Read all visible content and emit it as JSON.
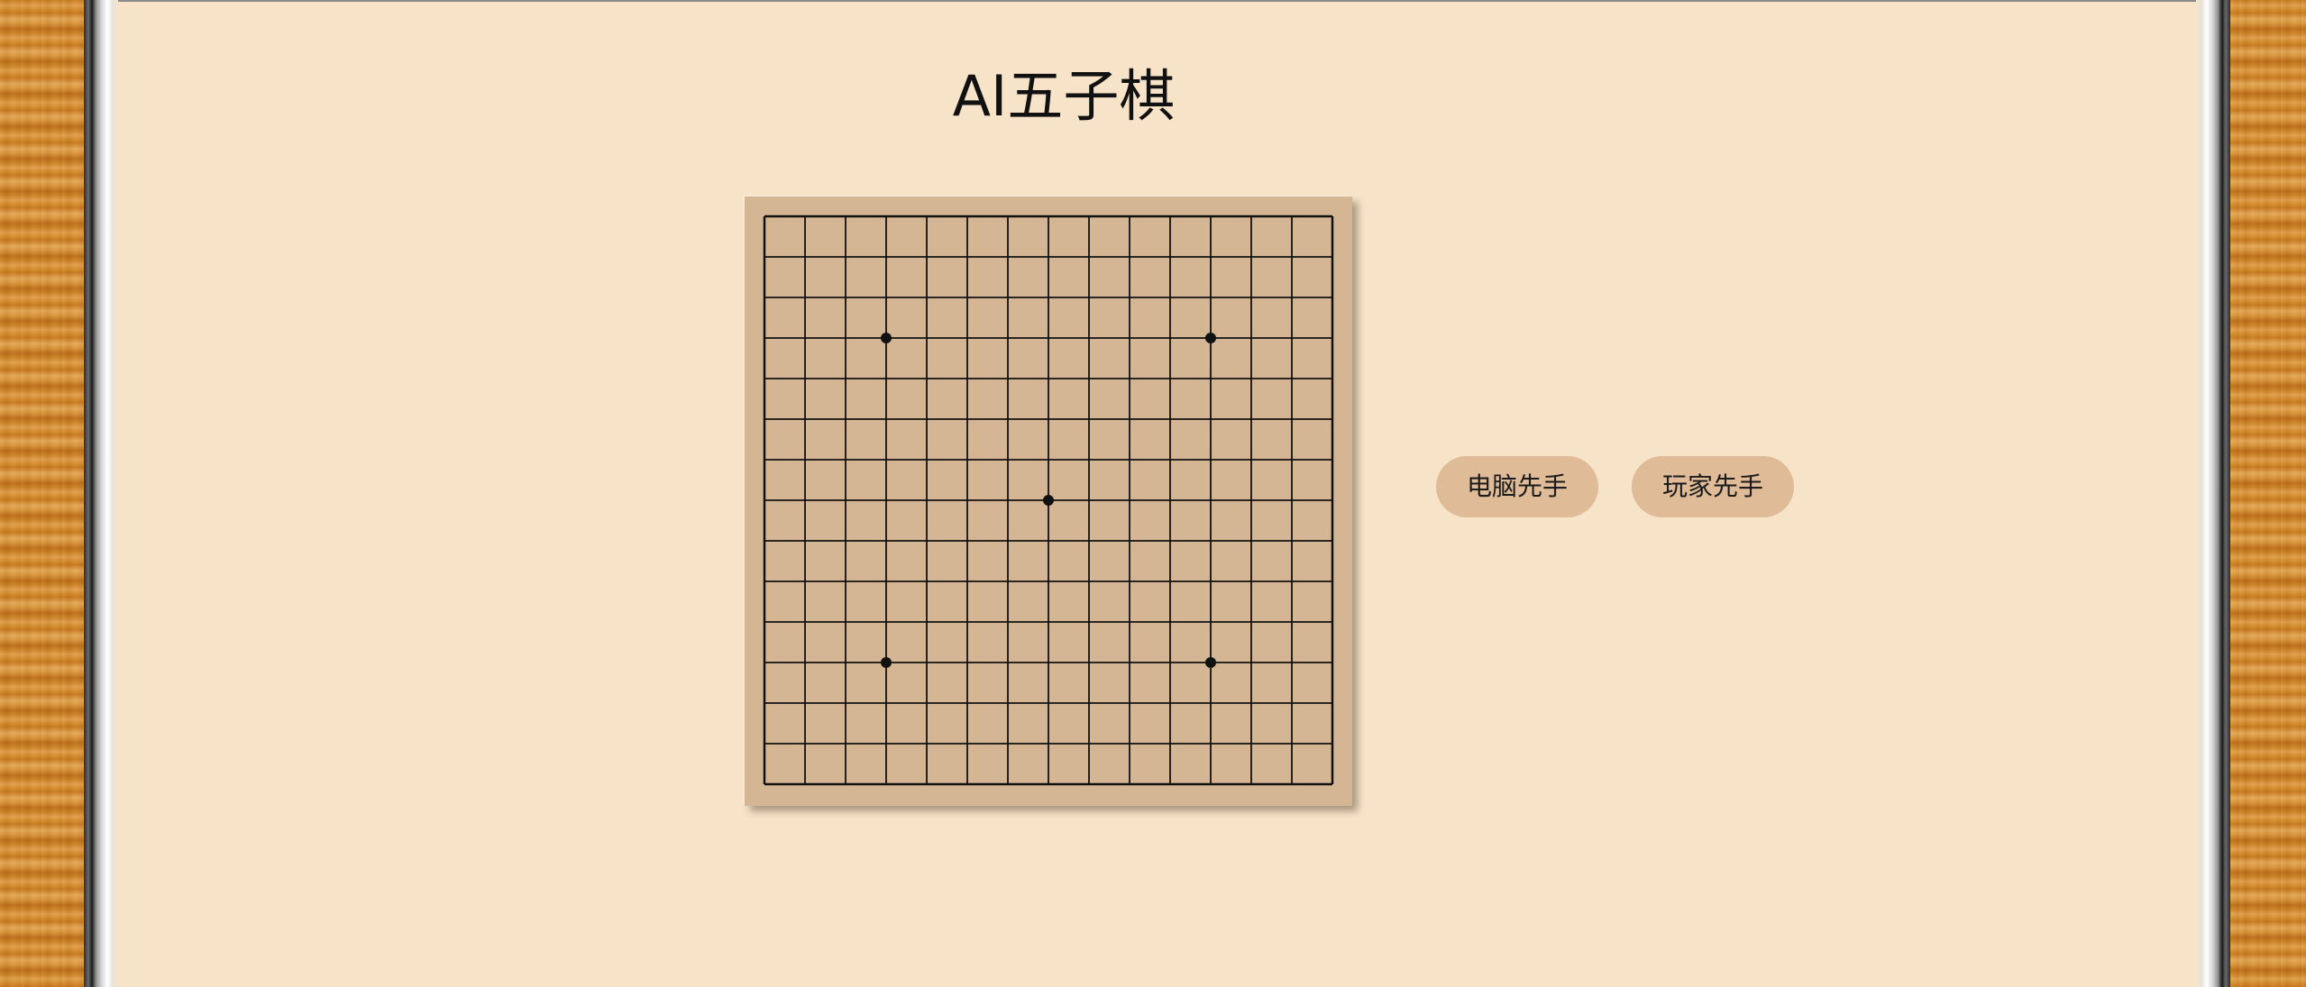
{
  "page": {
    "title": "AI五子棋"
  },
  "board": {
    "size": 15,
    "star_points": [
      [
        3,
        3
      ],
      [
        3,
        11
      ],
      [
        7,
        7
      ],
      [
        11,
        3
      ],
      [
        11,
        11
      ]
    ],
    "stones": [],
    "line_color": "#111111",
    "board_color": "#d5b694"
  },
  "controls": {
    "computer_first_label": "电脑先手",
    "player_first_label": "玩家先手"
  },
  "colors": {
    "background": "#f7e4c8",
    "button_bg": "#dfbb98",
    "wood": "#d98f2e"
  }
}
